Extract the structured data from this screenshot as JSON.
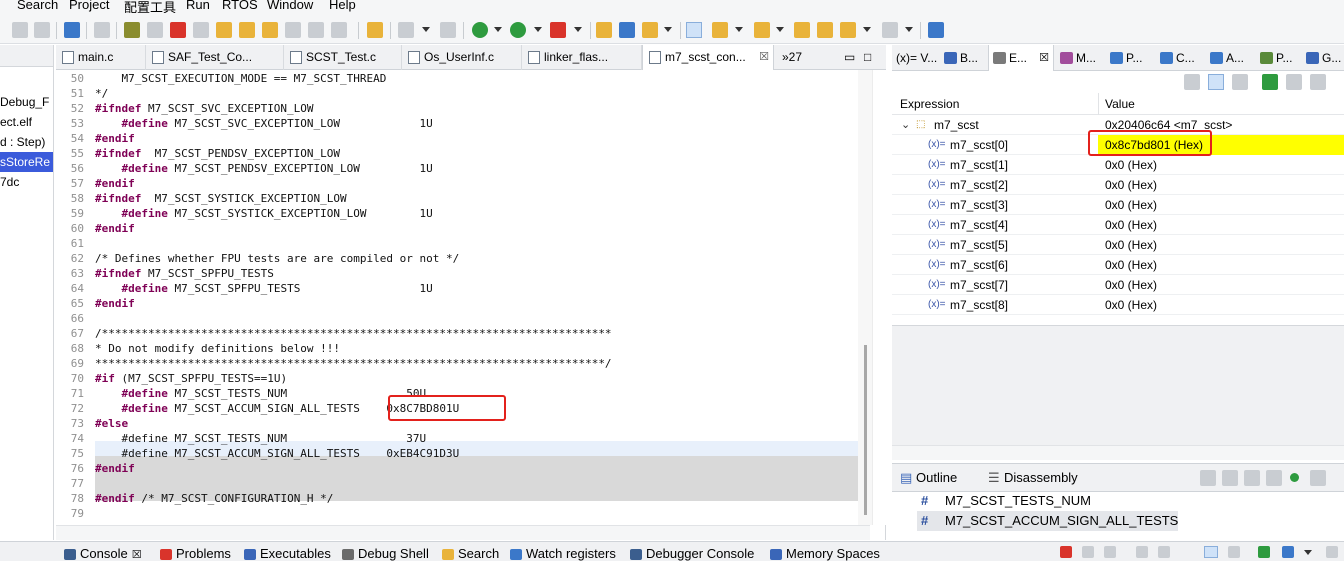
{
  "menu": [
    "Search",
    "Project",
    "配置工具",
    "Run",
    "RTOS",
    "Window",
    "Help"
  ],
  "left_panel": {
    "rows": [
      "Debug_F",
      "ect.elf",
      "d : Step)",
      "sStoreRe",
      "7dc"
    ]
  },
  "editor": {
    "tabs": [
      {
        "label": "main.c"
      },
      {
        "label": "SAF_Test_Co..."
      },
      {
        "label": "SCST_Test.c"
      },
      {
        "label": "Os_UserInf.c"
      },
      {
        "label": "linker_flas..."
      },
      {
        "label": "m7_scst_con...",
        "active": true,
        "close": "☒"
      },
      {
        "label": "»27"
      }
    ],
    "lines": [
      {
        "n": "50",
        "t": "    M7_SCST_EXECUTION_MODE == M7_SCST_THREAD",
        "c": "cmt"
      },
      {
        "n": "51",
        "t": "*/",
        "c": "cmt"
      },
      {
        "n": "52",
        "t": "#ifndef M7_SCST_SVC_EXCEPTION_LOW",
        "c": ""
      },
      {
        "n": "53",
        "t": "    #define M7_SCST_SVC_EXCEPTION_LOW            1U",
        "c": ""
      },
      {
        "n": "54",
        "t": "#endif",
        "c": ""
      },
      {
        "n": "55",
        "t": "#ifndef  M7_SCST_PENDSV_EXCEPTION_LOW",
        "c": ""
      },
      {
        "n": "56",
        "t": "    #define M7_SCST_PENDSV_EXCEPTION_LOW         1U",
        "c": ""
      },
      {
        "n": "57",
        "t": "#endif",
        "c": ""
      },
      {
        "n": "58",
        "t": "#ifndef  M7_SCST_SYSTICK_EXCEPTION_LOW",
        "c": ""
      },
      {
        "n": "59",
        "t": "    #define M7_SCST_SYSTICK_EXCEPTION_LOW        1U",
        "c": ""
      },
      {
        "n": "60",
        "t": "#endif",
        "c": ""
      },
      {
        "n": "61",
        "t": "",
        "c": ""
      },
      {
        "n": "62",
        "t": "/* Defines whether FPU tests are are compiled or not */",
        "c": "cmt"
      },
      {
        "n": "63",
        "t": "#ifndef M7_SCST_SPFPU_TESTS",
        "c": ""
      },
      {
        "n": "64",
        "t": "    #define M7_SCST_SPFPU_TESTS                  1U",
        "c": ""
      },
      {
        "n": "65",
        "t": "#endif",
        "c": ""
      },
      {
        "n": "66",
        "t": "",
        "c": ""
      },
      {
        "n": "67",
        "t": "/*****************************************************************************",
        "c": "cmt"
      },
      {
        "n": "68",
        "t": "* Do not modify definitions below !!!",
        "c": "cmt"
      },
      {
        "n": "69",
        "t": "*****************************************************************************/",
        "c": "cmt"
      },
      {
        "n": "70",
        "t": "#if (M7_SCST_SPFPU_TESTS==1U)",
        "c": ""
      },
      {
        "n": "71",
        "t": "    #define M7_SCST_TESTS_NUM                  50U",
        "c": ""
      },
      {
        "n": "72",
        "t": "    #define M7_SCST_ACCUM_SIGN_ALL_TESTS    0x8C7BD801U",
        "c": ""
      },
      {
        "n": "73",
        "t": "#else",
        "c": ""
      },
      {
        "n": "74",
        "t": "    #define M7_SCST_TESTS_NUM                  37U",
        "c": "dim"
      },
      {
        "n": "75",
        "t": "    #define M7_SCST_ACCUM_SIGN_ALL_TESTS    0xEB4C91D3U",
        "c": "dim"
      },
      {
        "n": "76",
        "t": "#endif",
        "c": ""
      },
      {
        "n": "77",
        "t": "",
        "c": ""
      },
      {
        "n": "78",
        "t": "#endif /* M7_SCST_CONFIGURATION_H */",
        "c": ""
      },
      {
        "n": "79",
        "t": "",
        "c": ""
      }
    ]
  },
  "expressions": {
    "tabs": [
      {
        "label": "(x)= V..."
      },
      {
        "label": "B..."
      },
      {
        "label": "E...",
        "active": true
      },
      {
        "label": "M..."
      },
      {
        "label": "P..."
      },
      {
        "label": "C..."
      },
      {
        "label": "A..."
      },
      {
        "label": "P..."
      },
      {
        "label": "G..."
      }
    ],
    "col_expression": "Expression",
    "col_value": "Value",
    "root": {
      "name": "m7_scst",
      "value": "0x20406c64 <m7_scst>"
    },
    "rows": [
      {
        "name": "m7_scst[0]",
        "value": "0x8c7bd801 (Hex)",
        "highlight": true
      },
      {
        "name": "m7_scst[1]",
        "value": "0x0 (Hex)"
      },
      {
        "name": "m7_scst[2]",
        "value": "0x0 (Hex)"
      },
      {
        "name": "m7_scst[3]",
        "value": "0x0 (Hex)"
      },
      {
        "name": "m7_scst[4]",
        "value": "0x0 (Hex)"
      },
      {
        "name": "m7_scst[5]",
        "value": "0x0 (Hex)"
      },
      {
        "name": "m7_scst[6]",
        "value": "0x0 (Hex)"
      },
      {
        "name": "m7_scst[7]",
        "value": "0x0 (Hex)"
      },
      {
        "name": "m7_scst[8]",
        "value": "0x0 (Hex)"
      }
    ],
    "highlight_color": "#ffff00"
  },
  "outline": {
    "tabs": [
      {
        "label": "Outline"
      },
      {
        "label": "Disassembly"
      }
    ],
    "items": [
      {
        "label": "M7_SCST_TESTS_NUM"
      },
      {
        "label": "M7_SCST_ACCUM_SIGN_ALL_TESTS",
        "selected": true
      }
    ]
  },
  "bottom_tabs": [
    {
      "label": "Console"
    },
    {
      "label": "Problems"
    },
    {
      "label": "Executables"
    },
    {
      "label": "Debug Shell"
    },
    {
      "label": "Search"
    },
    {
      "label": "Watch registers"
    },
    {
      "label": "Debugger Console"
    },
    {
      "label": "Memory Spaces"
    }
  ],
  "colors": {
    "annotation_red": "#e3211c",
    "keyword": "#7f0055",
    "comment": "#3f7f5f"
  }
}
